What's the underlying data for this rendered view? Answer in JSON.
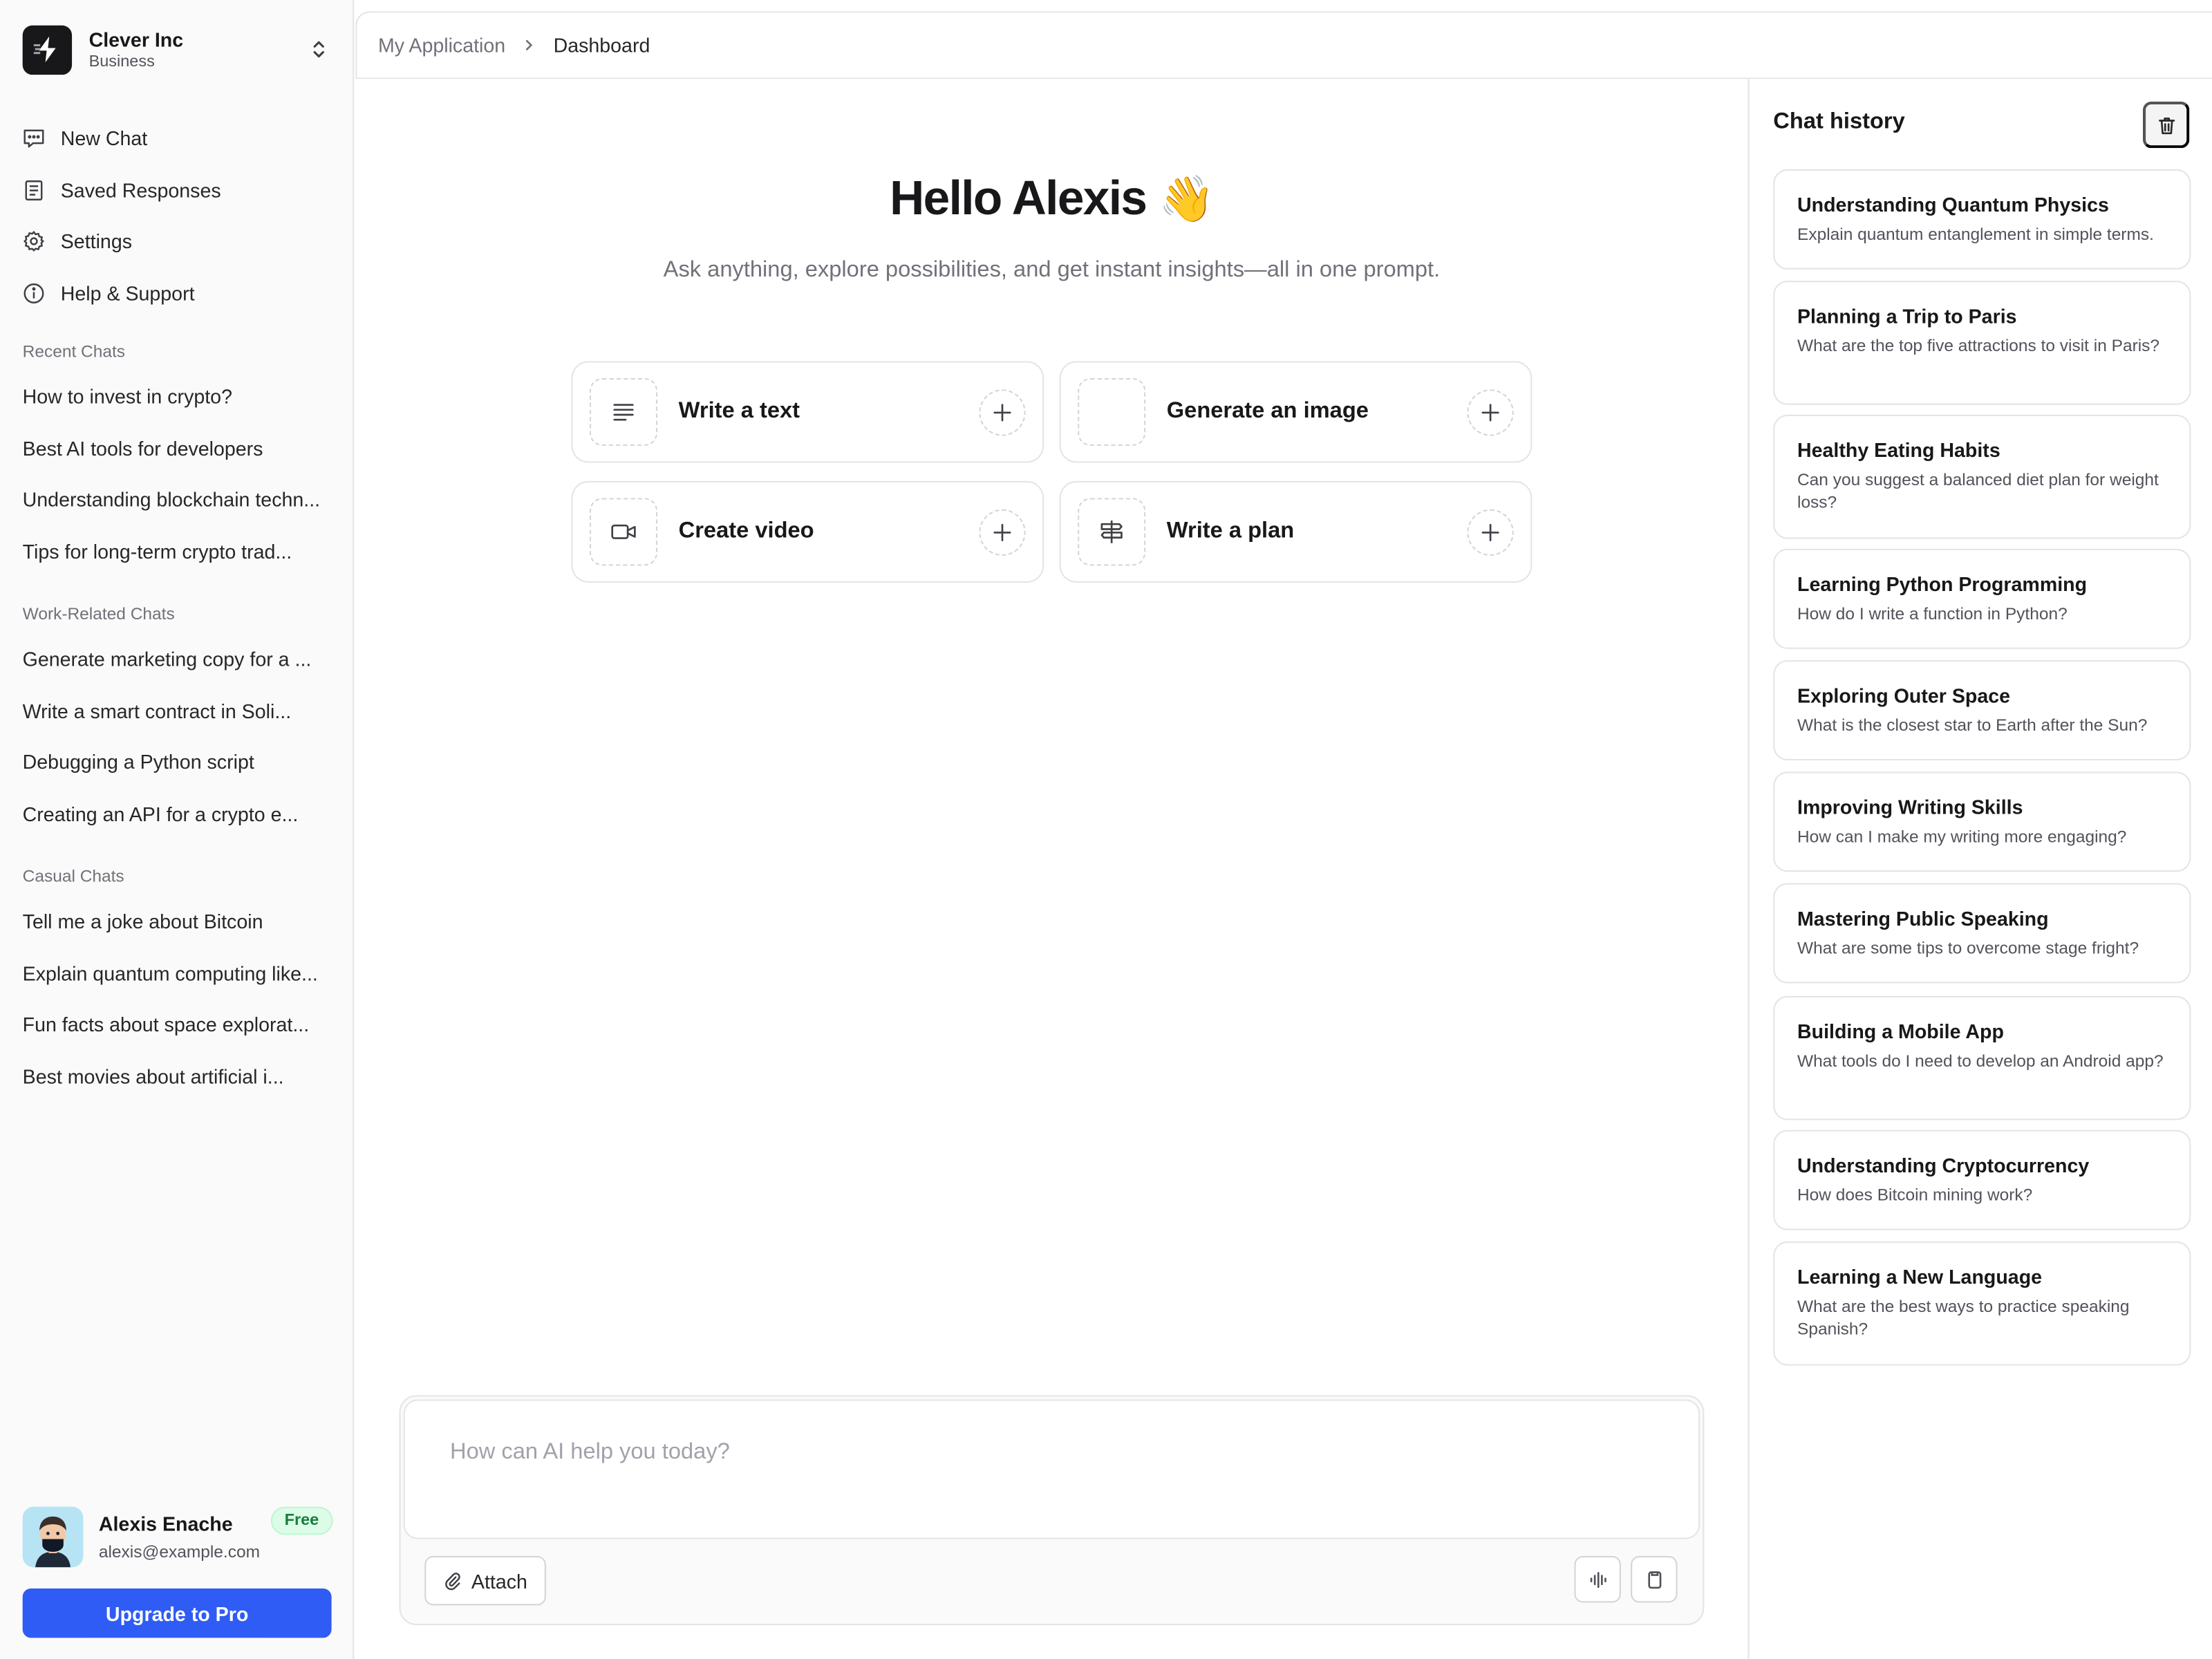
{
  "org": {
    "name": "Clever Inc",
    "plan": "Business"
  },
  "nav": [
    {
      "label": "New Chat",
      "icon": "chat-icon"
    },
    {
      "label": "Saved Responses",
      "icon": "document-icon"
    },
    {
      "label": "Settings",
      "icon": "gear-icon"
    },
    {
      "label": "Help & Support",
      "icon": "info-icon"
    }
  ],
  "groups": {
    "recent": {
      "title": "Recent Chats",
      "items": [
        "How to invest in crypto?",
        "Best AI tools for developers",
        "Understanding blockchain techn...",
        "Tips for long-term crypto trad..."
      ]
    },
    "work": {
      "title": "Work-Related Chats",
      "items": [
        "Generate marketing copy for a ...",
        "Write a smart contract in Soli...",
        "Debugging a Python script",
        "Creating an API for a crypto e..."
      ]
    },
    "casual": {
      "title": "Casual Chats",
      "items": [
        "Tell me a joke about Bitcoin",
        "Explain quantum computing like...",
        "Fun facts about space explorat...",
        "Best movies about artificial i..."
      ]
    }
  },
  "user": {
    "name": "Alexis Enache",
    "email": "alexis@example.com",
    "badge": "Free",
    "upgrade_label": "Upgrade to Pro"
  },
  "breadcrumb": {
    "parent": "My Application",
    "current": "Dashboard"
  },
  "main": {
    "greeting": "Hello Alexis",
    "wave": "👋",
    "subtitle": "Ask anything, explore possibilities, and get instant insights—all in one prompt.",
    "actions": [
      {
        "label": "Write a text",
        "icon": "text-lines-icon"
      },
      {
        "label": "Generate an image",
        "icon": "image-icon"
      },
      {
        "label": "Create video",
        "icon": "video-icon"
      },
      {
        "label": "Write a plan",
        "icon": "signpost-icon"
      }
    ]
  },
  "composer": {
    "placeholder": "How can AI help you today?",
    "attach_label": "Attach"
  },
  "history": {
    "title": "Chat history",
    "items": [
      {
        "title": "Understanding Quantum Physics",
        "subtitle": "Explain quantum entanglement in simple terms."
      },
      {
        "title": "Planning a Trip to Paris",
        "subtitle": "What are the top five attractions to visit in Paris?"
      },
      {
        "title": "Healthy Eating Habits",
        "subtitle": "Can you suggest a balanced diet plan for weight loss?"
      },
      {
        "title": "Learning Python Programming",
        "subtitle": "How do I write a function in Python?"
      },
      {
        "title": "Exploring Outer Space",
        "subtitle": "What is the closest star to Earth after the Sun?"
      },
      {
        "title": "Improving Writing Skills",
        "subtitle": "How can I make my writing more engaging?"
      },
      {
        "title": "Mastering Public Speaking",
        "subtitle": "What are some tips to overcome stage fright?"
      },
      {
        "title": "Building a Mobile App",
        "subtitle": "What tools do I need to develop an Android app?"
      },
      {
        "title": "Understanding Cryptocurrency",
        "subtitle": "How does Bitcoin mining work?"
      },
      {
        "title": "Learning a New Language",
        "subtitle": "What are the best ways to practice speaking Spanish?"
      }
    ]
  },
  "colors": {
    "accent": "#2f5cf5",
    "badge_bg": "#dcfce7",
    "badge_text": "#15803d",
    "border": "#e4e4e7"
  }
}
